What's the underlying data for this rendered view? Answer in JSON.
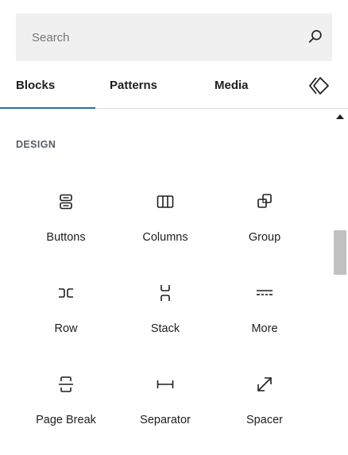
{
  "search": {
    "placeholder": "Search",
    "value": ""
  },
  "tabs": [
    {
      "label": "Blocks",
      "active": true
    },
    {
      "label": "Patterns",
      "active": false
    },
    {
      "label": "Media",
      "active": false
    }
  ],
  "accent_color": "#2271b1",
  "category": {
    "title": "DESIGN"
  },
  "blocks": [
    {
      "label": "Buttons",
      "icon": "buttons-icon"
    },
    {
      "label": "Columns",
      "icon": "columns-icon"
    },
    {
      "label": "Group",
      "icon": "group-icon"
    },
    {
      "label": "Row",
      "icon": "row-icon"
    },
    {
      "label": "Stack",
      "icon": "stack-icon"
    },
    {
      "label": "More",
      "icon": "more-icon"
    },
    {
      "label": "Page Break",
      "icon": "page-break-icon"
    },
    {
      "label": "Separator",
      "icon": "separator-icon"
    },
    {
      "label": "Spacer",
      "icon": "spacer-icon"
    }
  ]
}
